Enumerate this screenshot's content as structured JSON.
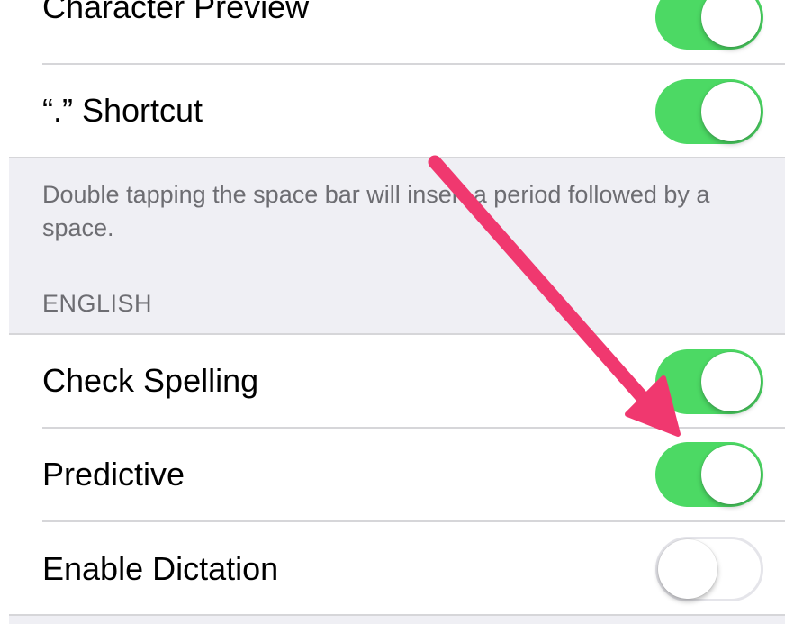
{
  "settings": {
    "rows": [
      {
        "label": "Character Preview",
        "on": true
      },
      {
        "label": "“.” Shortcut",
        "on": true
      },
      {
        "label": "Check Spelling",
        "on": true
      },
      {
        "label": "Predictive",
        "on": true
      },
      {
        "label": "Enable Dictation",
        "on": false
      }
    ],
    "shortcut_footer": "Double tapping the space bar will insert a period followed by a space.",
    "english_header": "ENGLISH"
  },
  "colors": {
    "toggle_on": "#4cd964",
    "toggle_off_border": "#e5e5ea",
    "group_background": "#efeff4",
    "secondary_text": "#6d6d72",
    "annotation_arrow": "#f0386f"
  },
  "icons": {
    "annotation": "arrow-annotation-icon"
  }
}
